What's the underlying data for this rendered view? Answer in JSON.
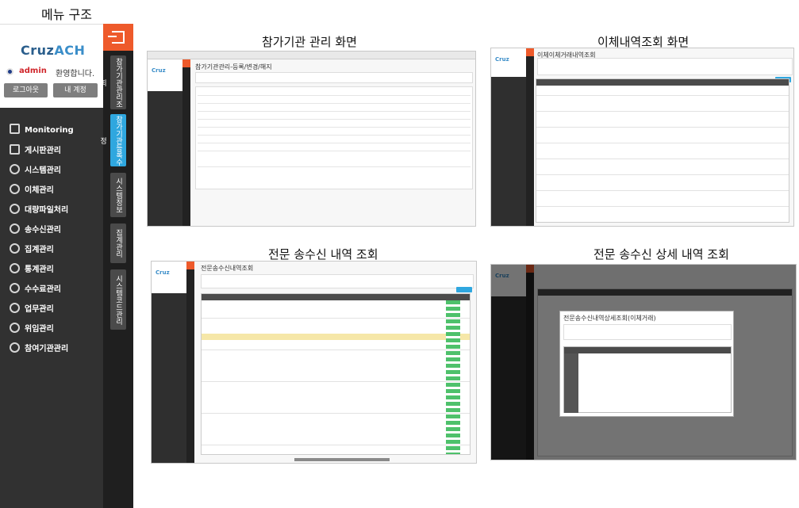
{
  "menu_caption": "메뉴 구조",
  "menu": {
    "logo_main": "Cruz",
    "logo_accent": "ACH",
    "user": "admin",
    "greeting": "환영합니다.",
    "logout_label": "로그아웃",
    "account_label": "내 계정",
    "items": [
      {
        "label": "Monitoring",
        "icon": "monitor-icon"
      },
      {
        "label": "게시판관리",
        "icon": "board-icon"
      },
      {
        "label": "시스템관리",
        "icon": "gear-icon"
      },
      {
        "label": "이체관리",
        "icon": "gear-icon"
      },
      {
        "label": "대량파일처리",
        "icon": "gear-icon"
      },
      {
        "label": "송수신관리",
        "icon": "gear-icon"
      },
      {
        "label": "집계관리",
        "icon": "gear-icon"
      },
      {
        "label": "통계관리",
        "icon": "gear-icon"
      },
      {
        "label": "수수료관리",
        "icon": "gear-icon"
      },
      {
        "label": "업무관리",
        "icon": "gear-icon"
      },
      {
        "label": "위임관리",
        "icon": "gear-icon"
      },
      {
        "label": "참여기관관리",
        "icon": "gear-icon"
      }
    ],
    "vertical_tabs": [
      {
        "label": "참가기관관리조회"
      },
      {
        "label": "참가기관등록수정"
      },
      {
        "label": "시스템정보"
      },
      {
        "label": "집계관리"
      },
      {
        "label": "시스템코드관리"
      }
    ],
    "colors": {
      "accent": "#ee5a2b",
      "tab_active": "#2fa7df",
      "menu_bg": "#313131"
    }
  },
  "screens": [
    {
      "caption": "참가기관 관리 화면",
      "title": "참가기관관리-등록/변경/해지"
    },
    {
      "caption": "이체내역조회 화면",
      "title": "이체이체거래내역조회"
    },
    {
      "caption": "전문 송수신 내역 조회",
      "title": "전문송수신내역조회"
    },
    {
      "caption": "전문 송수신 상세 내역 조회",
      "title": "전문송수신내역상세조회(이체거래)"
    }
  ]
}
